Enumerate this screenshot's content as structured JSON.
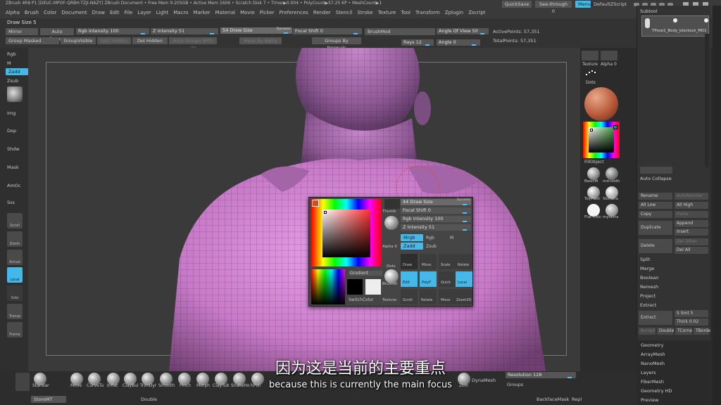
{
  "titlebar": {
    "text": "ZBrush 4R8 P1 [DEUC-MPOF-QRBH-TZJI-NAZY]   ZBrush Document     • Free Mem 9.205GB • Active Mem 1606 • Scratch Disk 7 • Timer▶0.004 • PolyCount▶57.25 KP • MeshCount▶1",
    "quicksave": "QuickSave",
    "seethrough": "See-through  0",
    "menus": "Menus",
    "default_zscript": "DefaultZScript"
  },
  "menu": [
    "Alpha",
    "Brush",
    "Color",
    "Document",
    "Draw",
    "Edit",
    "File",
    "Layer",
    "Light",
    "Macro",
    "Marker",
    "Material",
    "Movie",
    "Picker",
    "Preferences",
    "Render",
    "Stencil",
    "Stroke",
    "Texture",
    "Tool",
    "Transform",
    "Zplugin",
    "Zscript"
  ],
  "topbar": {
    "draw_size_title": "Draw Size 5",
    "mirror": "Mirror",
    "auto_groups": "Auto Groups",
    "rgb_intensity": "Rgb Intensity 100",
    "z_intensity": "Z Intensity 51",
    "draw_size": "54 Draw Size",
    "dynamic": "Dynamic",
    "focal_shift": "Focal Shift 0",
    "brush_mod": "BrushMod",
    "angle_of_view": "Angle Of View 50",
    "active_points": "ActivePoints: 57,351",
    "group_masked": "Group Masked",
    "group_visible": "GroupVisible",
    "split_hidden": "Split Hidden",
    "del_hidden": "Del Hidden",
    "auto_groups_uv": "Auto Groups With UV",
    "mask_by_alpha": "Mask By Alpha",
    "groups_by_normals": "Groups By Normals",
    "rays": "Rays  12",
    "angle": "Angle  0",
    "total_points": "TotalPoints: 57,351"
  },
  "leftbar": {
    "items": [
      "Rgb",
      "M",
      "Zadd",
      "Zsub"
    ],
    "icons_text": [
      "Img",
      "Dep",
      "Shdw",
      "Mask",
      "AmOc",
      "Sss"
    ],
    "tools": [
      "Scroll",
      "Zoom",
      "Actual",
      "Local",
      "Solo",
      "Transp",
      "Frame"
    ]
  },
  "right_mid": {
    "texture": "Texture",
    "alpha": "Alpha 0",
    "dots": "Dots",
    "fill_object": "FillObject",
    "materials": [
      "BasicM",
      "md-cloth",
      "ToyPlast",
      "SkinSha",
      "Flat Colc",
      "myskins"
    ]
  },
  "subtool": {
    "title": "Subtool",
    "item": "TPose1_Body_blockout_MD1",
    "auto_collapse": "Auto Collapse",
    "buttons": [
      "Rename",
      "AutoReorder",
      "All Low",
      "All High",
      "Copy",
      "Paste",
      "Duplicate",
      "Append",
      "Insert",
      "Delete",
      "Del Other",
      "Del All",
      "Split",
      "Merge",
      "Boolean",
      "Remesh",
      "Project",
      "Extract",
      "Extract",
      "S Smt 5",
      "Thick 0.02",
      "Accept",
      "Double",
      "TCorne",
      "TBorde"
    ],
    "sections": [
      "Geometry",
      "ArrayMesh",
      "NanoMesh",
      "Layers",
      "FiberMesh",
      "Geometry HD",
      "Preview"
    ]
  },
  "popup": {
    "gradient": "Gradient",
    "switch_color": "SwitchColor",
    "thumb": "Thumb",
    "alpha": "Alpha 0",
    "dots": "Dots",
    "brush_thumb": "BrushAl",
    "texture": "Texture",
    "draw_size": "44 Draw Size",
    "dynamic": "Dynamic",
    "focal_shift": "Focal Shift 0",
    "rgb_intensity": "Rgb Intensity 100",
    "z_intensity": "Z Intensity 51",
    "mrgb": "Mrgb",
    "rgb": "Rgb",
    "m": "M",
    "zadd": "Zadd",
    "zsub": "Zsub",
    "tools": [
      "Draw",
      "Move",
      "Scale",
      "Rotate"
    ],
    "tools2": [
      "Edit",
      "PolyF",
      "Quick",
      "Local"
    ],
    "tools3": [
      "Scroll",
      "Rotate",
      "Move",
      "Zoom3D"
    ]
  },
  "bottom": {
    "brushes": [
      "Standar",
      "Move",
      "CurveTu",
      "Inflat",
      "ClayBui",
      "TrimDyr",
      "Smooth",
      "Pinch",
      "Morph",
      "ClayTub",
      "SnakeHo",
      "hPoli",
      "DamStd",
      "Planar",
      "ZModel",
      "Zcin",
      "Zcin"
    ],
    "dynamesh": "DynaMesh",
    "resolution": "Resolution 128",
    "groups": "Groups",
    "store_mt": "StoreMT",
    "double": "Double",
    "backface_mask": "BackfaceMask",
    "repl": "Repl"
  },
  "subtitles": {
    "chinese": "因为这是当前的主要重点",
    "english": "because this is currently the main focus"
  }
}
